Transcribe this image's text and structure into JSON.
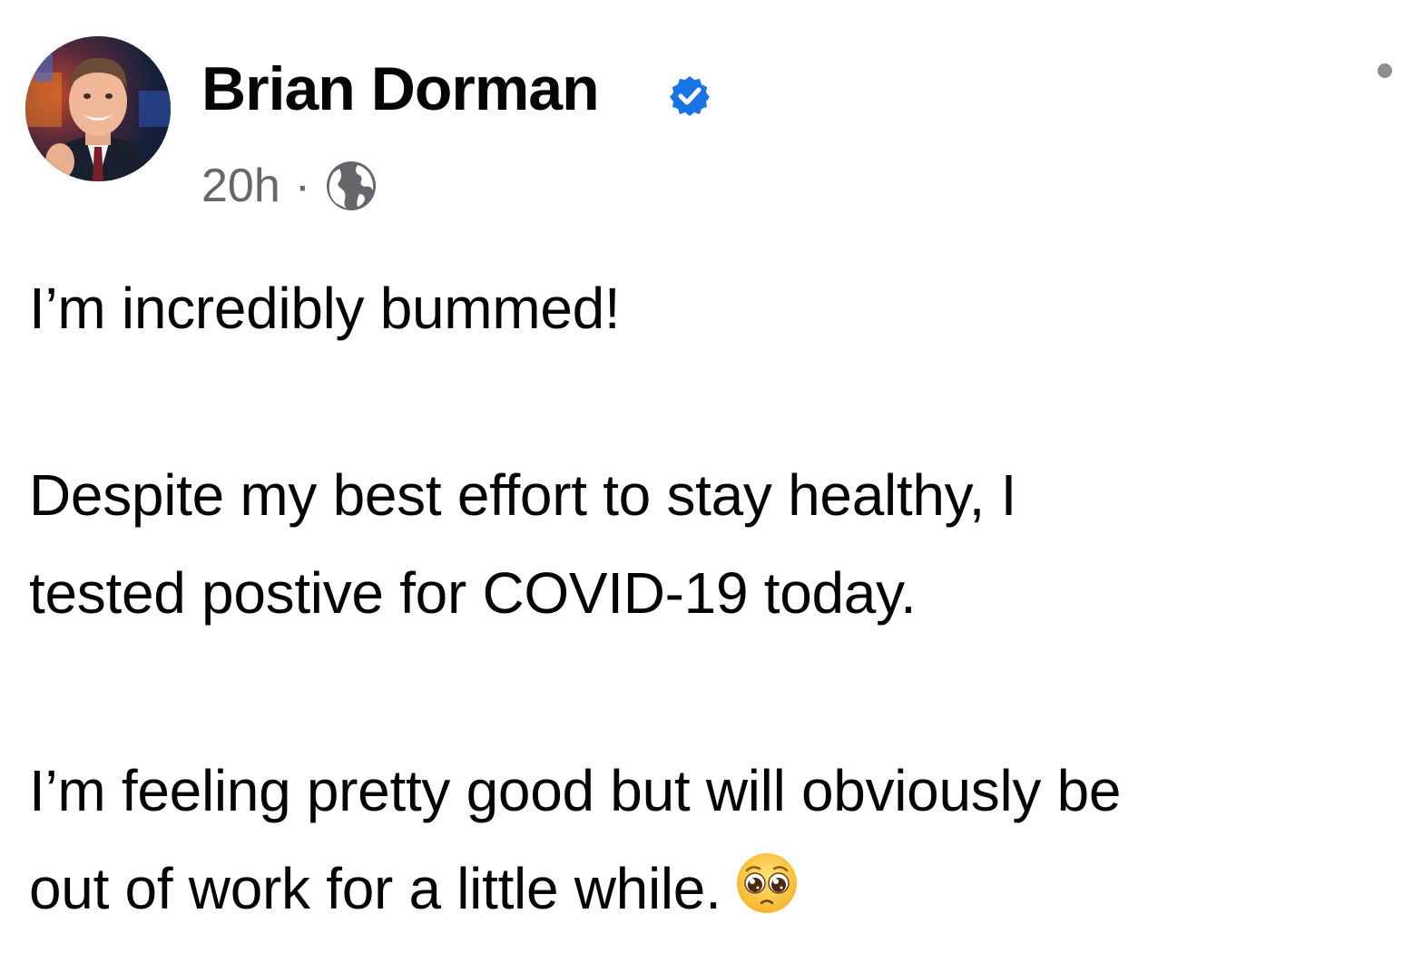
{
  "post": {
    "author_name": "Brian Dorman",
    "verified": true,
    "timestamp": "20h",
    "separator": "·",
    "audience_icon": "globe-icon",
    "more_icon": "more-options-icon",
    "accent_color": "#1b74e4",
    "text_line_1": "I’m incredibly bummed!",
    "text_line_2": "Despite my best effort to stay healthy, I",
    "text_line_3": "tested postive for COVID-19 today.",
    "text_line_4": "I’m feeling pretty good but will obviously be",
    "text_line_5": "out of work for a little while.",
    "emoji": "pleading-face-emoji"
  }
}
